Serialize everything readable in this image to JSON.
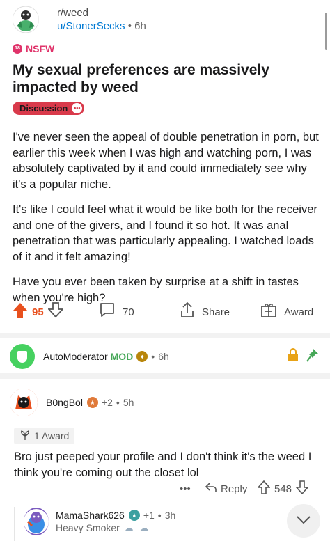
{
  "post": {
    "subreddit": "r/weed",
    "author": "u/StonerSecks",
    "age": "6h",
    "nsfw_label": "NSFW",
    "nsfw_badge": "18",
    "title": "My sexual preferences are massively impacted by weed",
    "flair": "Discussion",
    "body": [
      "I've never seen the appeal of double penetration in porn, but earlier this week when I was high and watching porn, I was absolutely captivated by it and could immediately see why it's a popular niche.",
      "It's like I could feel what it would be like both for the receiver and one of the givers, and I found it so hot. It was anal penetration that was particularly appealing. I watched loads of it and it felt amazing!",
      "Have you ever been taken by surprise at a shift in tastes when you're high?"
    ],
    "votes": "95",
    "comments": "70",
    "share_label": "Share",
    "award_label": "Award"
  },
  "comments": [
    {
      "username": "AutoModerator",
      "mod_tag": "MOD",
      "age": "6h"
    },
    {
      "username": "B0ngBol",
      "award_count": "+2",
      "age": "5h",
      "award_text": "1 Award",
      "body": "Bro just peeped your profile and I don't think it's the weed I think you're coming out the closet lol",
      "reply_label": "Reply",
      "votes": "548",
      "more": "•••"
    },
    {
      "username": "MamaShark626",
      "award_count": "+1",
      "age": "3h",
      "flair": "Heavy Smoker"
    }
  ],
  "colors": {
    "upvote": "#e8501e",
    "nsfw": "#e0336a",
    "flair": "#d93a4b",
    "mod": "#46a758",
    "link": "#0079d3"
  }
}
